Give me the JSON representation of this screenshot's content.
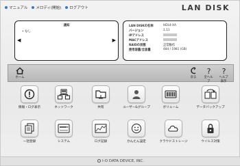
{
  "top_links": {
    "manual": "マニュアル",
    "melody": "メロディ(開始)",
    "logout": "ログアウト"
  },
  "brand": {
    "logo": "LAN DISK"
  },
  "notice": {
    "title": "通知",
    "items": [
      "なし"
    ]
  },
  "info": {
    "rows": [
      {
        "label": "LAN DISKの名称",
        "value": "HDL4-XA"
      },
      {
        "label": "バージョン",
        "value": "1.11"
      },
      {
        "label": "IPアドレス",
        "value": ""
      },
      {
        "label": "MACアドレス",
        "value": ""
      },
      {
        "label": "RAIDの状態",
        "value": "正常動作"
      },
      {
        "label": "使用容量/全容量",
        "value": "484 / 1981 (GB)"
      }
    ]
  },
  "toolbar": {
    "home": "ホーム",
    "back": "戻る",
    "help_all": "全ヘルプ",
    "help_page": "ヘルプ表示"
  },
  "tiles": [
    {
      "label": "情報・ログ表示",
      "icon": "info-log-icon"
    },
    {
      "label": "ネットワーク",
      "icon": "network-icon"
    },
    {
      "label": "共有",
      "icon": "share-folder-icon"
    },
    {
      "label": "ユーザー&グループ",
      "icon": "users-groups-icon"
    },
    {
      "label": "ボリューム",
      "icon": "volume-icon"
    },
    {
      "label": "データバックアップ",
      "icon": "data-backup-icon"
    },
    {
      "label": "一括登録",
      "icon": "batch-register-icon"
    },
    {
      "label": "システム",
      "icon": "system-icon"
    },
    {
      "label": "ログ記録",
      "icon": "log-record-icon"
    },
    {
      "label": "かんたん設定",
      "icon": "easy-setup-icon"
    },
    {
      "label": "クラウドストレージ",
      "icon": "cloud-storage-icon"
    },
    {
      "label": "ウイルス対策",
      "icon": "antivirus-icon"
    }
  ],
  "footer": {
    "company": "I-O DATA DEVICE, INC."
  }
}
